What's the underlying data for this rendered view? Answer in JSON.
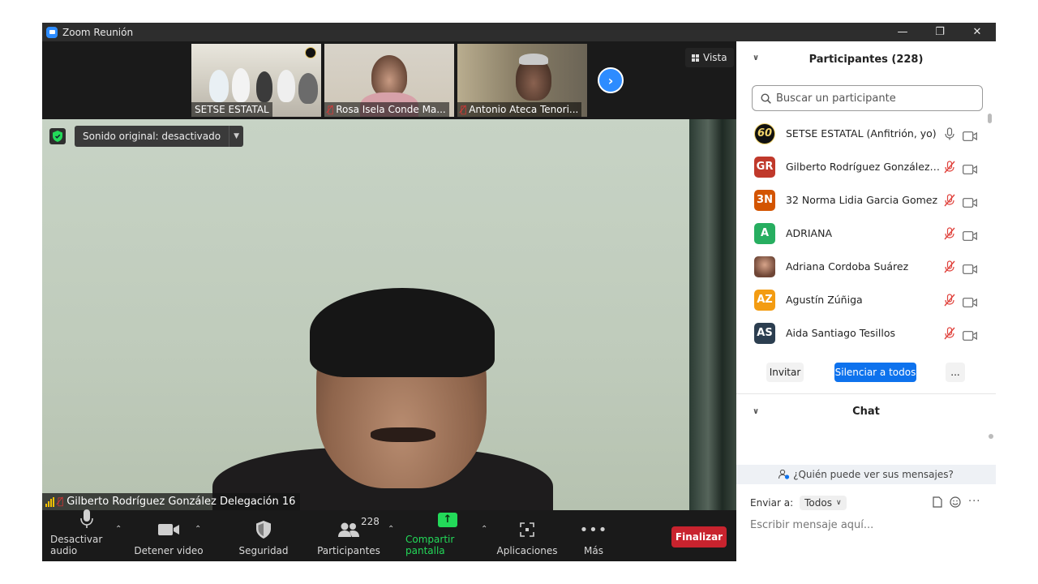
{
  "window": {
    "title": "Zoom Reunión",
    "minimize": "—",
    "restore": "❐",
    "close": "✕"
  },
  "gallery": {
    "tiles": [
      {
        "name": "SETSE ESTATAL",
        "muted": false
      },
      {
        "name": "Rosa Isela Conde Ma...",
        "muted": true
      },
      {
        "name": "Antonio Ateca Tenori...",
        "muted": true
      }
    ],
    "view_label": "Vista"
  },
  "main_video": {
    "sound_original": "Sonido original: desactivado",
    "speaker_name": "Gilberto Rodríguez González Delegación 16"
  },
  "toolbar": {
    "mute_label": "Desactivar audio",
    "video_label": "Detener video",
    "security_label": "Seguridad",
    "participants_label": "Participantes",
    "participants_count": "228",
    "share_label": "Compartir pantalla",
    "apps_label": "Aplicaciones",
    "more_label": "Más",
    "end_label": "Finalizar",
    "colors": {
      "share_green": "#23d959",
      "end_red": "#c8232e"
    }
  },
  "participants_panel": {
    "title": "Participantes (228)",
    "search_placeholder": "Buscar un participante",
    "participants": [
      {
        "initials": "60",
        "name": "SETSE ESTATAL (Anfitrión, yo)",
        "color": "#111111",
        "muted": false
      },
      {
        "initials": "GR",
        "name": "Gilberto Rodríguez González D...",
        "color": "#c0392b",
        "muted": true
      },
      {
        "initials": "3N",
        "name": "32 Norma Lidia Garcia Gomez",
        "color": "#d35400",
        "muted": true
      },
      {
        "initials": "A",
        "name": "ADRIANA",
        "color": "#27ae60",
        "muted": true
      },
      {
        "initials": "",
        "name": "Adriana Cordoba Suárez",
        "color": "#8a5a44",
        "muted": true
      },
      {
        "initials": "AZ",
        "name": "Agustín Zúñiga",
        "color": "#f39c12",
        "muted": true
      },
      {
        "initials": "AS",
        "name": "Aida Santiago Tesillos",
        "color": "#2c3e50",
        "muted": true
      }
    ],
    "invite_label": "Invitar",
    "mute_all_label": "Silenciar a todos",
    "more_label": "..."
  },
  "chat_panel": {
    "title": "Chat",
    "who_can_see": "¿Quién puede ver sus mensajes?",
    "send_to_label": "Enviar a:",
    "send_to_value": "Todos",
    "input_placeholder": "Escribir mensaje aquí..."
  }
}
